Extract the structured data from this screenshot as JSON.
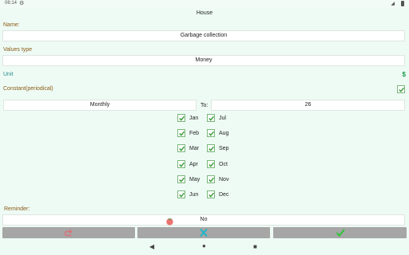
{
  "status": {
    "time": "06:14"
  },
  "title": "House",
  "name": {
    "label": "Name:",
    "value": "Garbage collection"
  },
  "values_type": {
    "label": "Values type",
    "value": "Money"
  },
  "unit": {
    "label": "Unit",
    "symbol": "$"
  },
  "constant": {
    "label": "Constant(periodical)",
    "checked": true
  },
  "period": {
    "value": "Monthly",
    "to_label": "To:",
    "to_value": "26"
  },
  "months_left": [
    {
      "label": "Jan",
      "checked": true
    },
    {
      "label": "Feb",
      "checked": true
    },
    {
      "label": "Mar",
      "checked": true
    },
    {
      "label": "Apr",
      "checked": true
    },
    {
      "label": "May",
      "checked": true
    },
    {
      "label": "Jun",
      "checked": true
    }
  ],
  "months_right": [
    {
      "label": "Jul",
      "checked": true
    },
    {
      "label": "Aug",
      "checked": true
    },
    {
      "label": "Sep",
      "checked": true
    },
    {
      "label": "Oct",
      "checked": true
    },
    {
      "label": "Nov",
      "checked": true
    },
    {
      "label": "Dec",
      "checked": true
    }
  ],
  "reminder": {
    "label": "Reminder:",
    "value": "No"
  },
  "buttons": {
    "back_icon": "undo-arrow-icon",
    "cancel_icon": "close-x-icon",
    "confirm_icon": "checkmark-icon"
  },
  "colors": {
    "accent_label": "#8a5a15",
    "unit_label": "#2a8a8a",
    "back_icon": "#d9737a",
    "cancel_icon": "#1fb5c9",
    "confirm_icon": "#2fc43a",
    "checkbox": "#3a9a3a"
  }
}
